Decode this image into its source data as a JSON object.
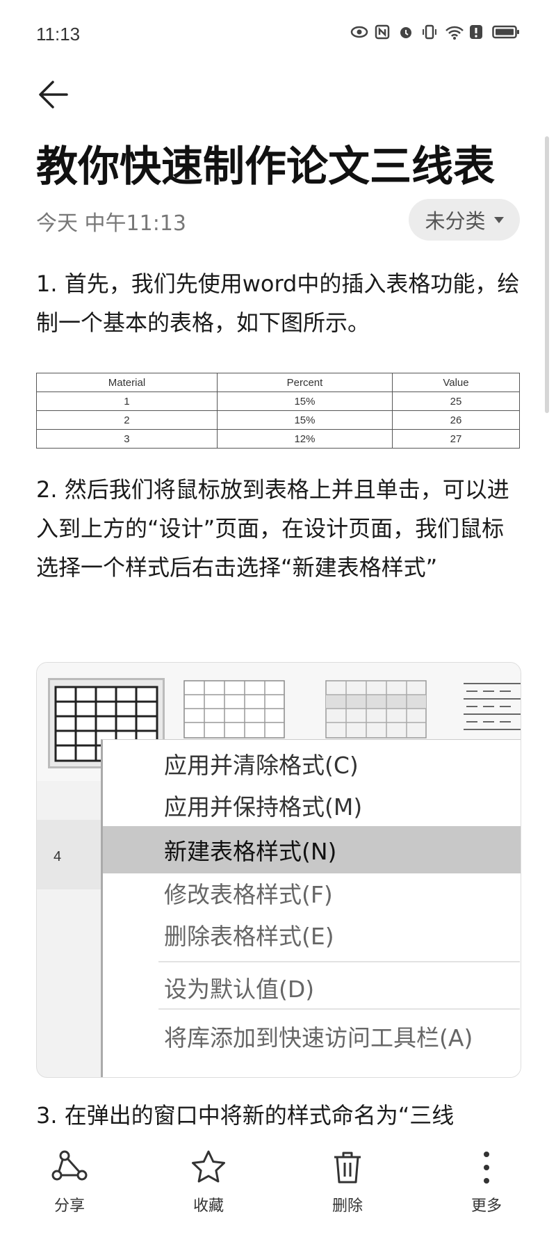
{
  "status_bar": {
    "time": "11:13",
    "icons": [
      "eye-icon",
      "nfc-icon",
      "alarm-icon",
      "vibrate-icon",
      "wifi-icon",
      "alert-icon",
      "battery-icon"
    ]
  },
  "note": {
    "title": "教你快速制作论文三线表",
    "timestamp": "今天 中午11:13",
    "category": "未分类",
    "step1": "1. 首先，我们先使用word中的插入表格功能，绘制一个基本的表格，如下图所示。",
    "table": {
      "headers": [
        "Material",
        "Percent",
        "Value"
      ],
      "rows": [
        [
          "1",
          "15%",
          "25"
        ],
        [
          "2",
          "15%",
          "26"
        ],
        [
          "3",
          "12%",
          "27"
        ]
      ]
    },
    "step2": "2. 然后我们将鼠标放到表格上并且单击，可以进入到上方的“设计”页面，在设计页面，我们鼠标选择一个样式后右击选择“新建表格样式”",
    "context_menu": {
      "row_number": "4",
      "items": [
        "应用并清除格式(C)",
        "应用并保持格式(M)",
        "新建表格样式(N)",
        "修改表格样式(F)",
        "删除表格样式(E)",
        "设为默认值(D)",
        "将库添加到快速访问工具栏(A)"
      ],
      "active_index": 2
    },
    "step3": "3. 在弹出的窗口中将新的样式命名为“三线"
  },
  "bottom_bar": {
    "share": "分享",
    "favorite": "收藏",
    "delete": "删除",
    "more": "更多"
  }
}
